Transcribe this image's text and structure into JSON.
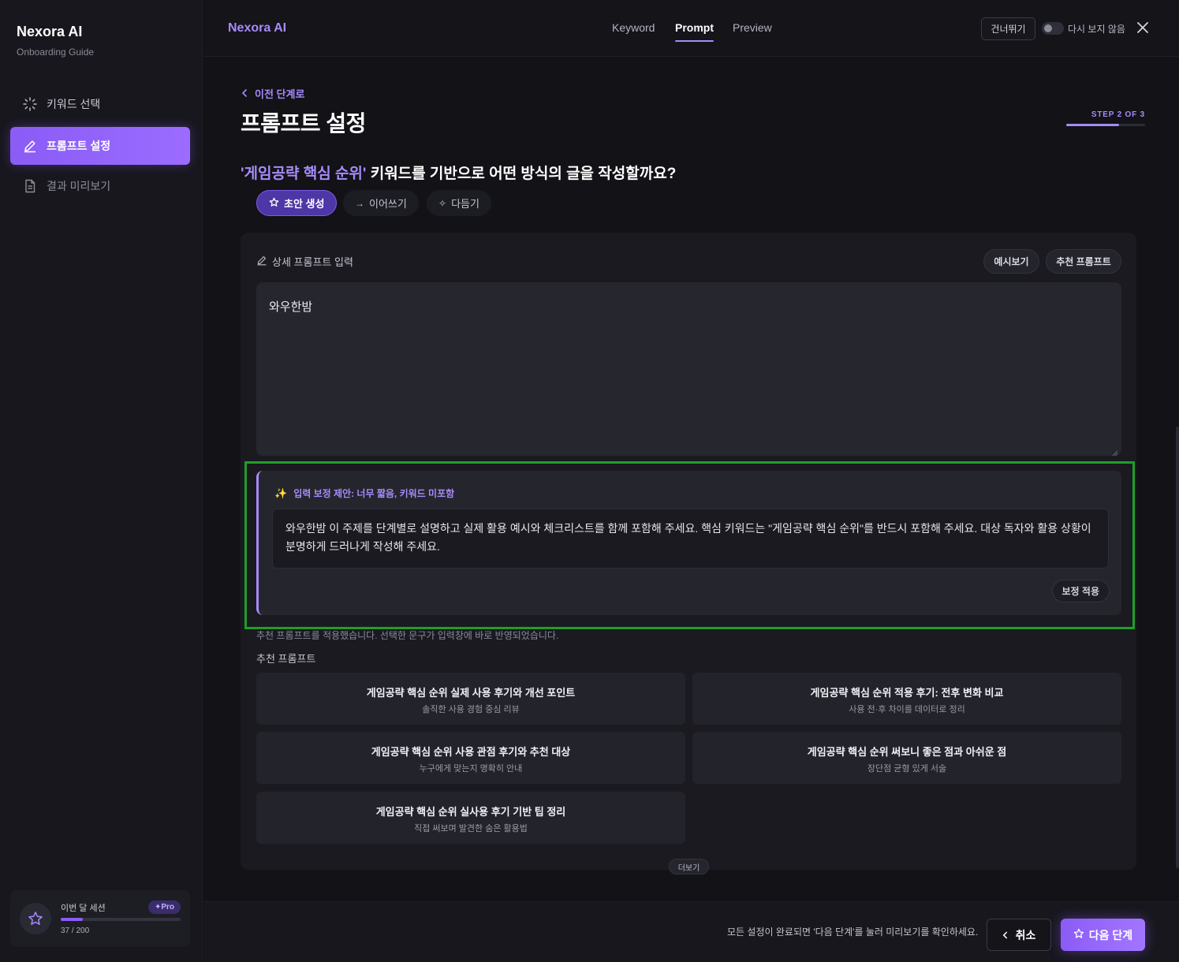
{
  "sidebar": {
    "brand": "Nexora AI",
    "subtitle": "Onboarding Guide",
    "items": [
      {
        "label": "키워드 선택",
        "icon": "loader-icon"
      },
      {
        "label": "프롬프트 설정",
        "icon": "pencil-icon"
      },
      {
        "label": "결과 미리보기",
        "icon": "document-icon"
      }
    ],
    "session": {
      "label": "이번 달 세션",
      "badge": "✦Pro",
      "count": "37 / 200",
      "progress_fraction": 0.185
    }
  },
  "topbar": {
    "brand": "Nexora AI",
    "tabs": [
      "Keyword",
      "Prompt",
      "Preview"
    ],
    "active_tab": "Prompt",
    "skip_label": "건너뛰기",
    "dont_show_label": "다시 보지 않음",
    "dont_show_enabled": false
  },
  "main": {
    "back_label": "이전 단계로",
    "title": "프롬프트 설정",
    "step_label": "STEP 2 OF 3",
    "step_fraction": 0.667,
    "question_keyword": "'게임공략 핵심 순위'",
    "question_rest": " 키워드를 기반으로 어떤 방식의 글을 작성할까요?",
    "modes": [
      {
        "label": "초안 생성",
        "icon": "star-icon"
      },
      {
        "label": "이어쓰기",
        "icon": "arrow-right-icon"
      },
      {
        "label": "다듬기",
        "icon": "sparkle-icon"
      }
    ],
    "active_mode": "초안 생성",
    "prompt_label": "상세 프롬프트 입력",
    "example_btn": "예시보기",
    "recommend_btn": "추천 프롬프트",
    "prompt_value": "와우한밤",
    "suggestion": {
      "title": "입력 보정 제안: 너무 짧음, 키워드 미포함",
      "text": "와우한밤 이 주제를 단계별로 설명하고 실제 활용 예시와 체크리스트를 함께 포함해 주세요. 핵심 키워드는 \"게임공략 핵심 순위\"를 반드시 포함해 주세요. 대상 독자와 활용 상황이 분명하게 드러나게 작성해 주세요.",
      "apply_label": "보정 적용"
    },
    "applied_message": "추천 프롬프트를 적용했습니다. 선택한 문구가 입력창에 바로 반영되었습니다.",
    "rec_heading": "추천 프롬프트",
    "recommendations": [
      {
        "title": "게임공략 핵심 순위 실제 사용 후기와 개선 포인트",
        "sub": "솔직한 사용 경험 중심 리뷰"
      },
      {
        "title": "게임공략 핵심 순위 적용 후기: 전후 변화 비교",
        "sub": "사용 전·후 차이를 데이터로 정리"
      },
      {
        "title": "게임공략 핵심 순위 사용 관점 후기와 추천 대상",
        "sub": "누구에게 맞는지 명확히 안내"
      },
      {
        "title": "게임공략 핵심 순위 써보니 좋은 점과 아쉬운 점",
        "sub": "장단점 균형 있게 서술"
      },
      {
        "title": "게임공략 핵심 순위 실사용 후기 기반 팁 정리",
        "sub": "직접 써보며 발견한 숨은 활용법"
      }
    ],
    "more_label": "더보기"
  },
  "footer": {
    "message": "모든 설정이 완료되면 '다음 단계'를 눌러 미리보기를 확인하세요.",
    "cancel_label": "취소",
    "next_label": "다음 단계"
  },
  "colors": {
    "accent": "#a78bfa",
    "accent_strong": "#8b5cf6",
    "background": "#121217",
    "highlight_border": "#1f9e2a"
  }
}
